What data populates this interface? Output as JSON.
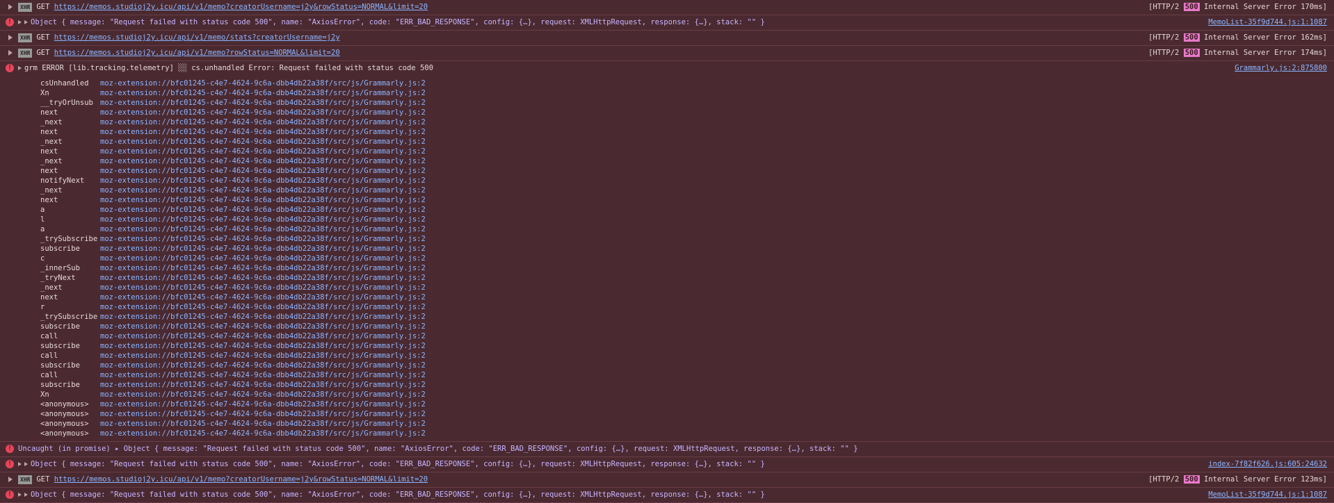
{
  "rows": [
    {
      "type": "xhr",
      "method": "GET",
      "url": "https://memos.studioj2y.icu/api/v1/memo?creatorUsername=j2y&rowStatus=NORMAL&limit=20",
      "status_prefix": "[HTTP/2",
      "status_code": "500",
      "status_suffix": "Internal Server Error 170ms]"
    },
    {
      "type": "error",
      "text": "Object { message: \"Request failed with status code 500\", name: \"AxiosError\", code: \"ERR_BAD_RESPONSE\", config: {…}, request: XMLHttpRequest, response: {…}, stack: \"\" }",
      "source": "MemoList-35f9d744.js:1:1087"
    },
    {
      "type": "xhr",
      "method": "GET",
      "url": "https://memos.studioj2y.icu/api/v1/memo/stats?creatorUsername=j2y",
      "status_prefix": "[HTTP/2",
      "status_code": "500",
      "status_suffix": "Internal Server Error 162ms]"
    },
    {
      "type": "xhr",
      "method": "GET",
      "url": "https://memos.studioj2y.icu/api/v1/memo?rowStatus=NORMAL&limit=20",
      "status_prefix": "[HTTP/2",
      "status_code": "500",
      "status_suffix": "Internal Server Error 174ms]"
    }
  ],
  "grm": {
    "text": "grm ERROR [lib.tracking.telemetry] ░░ cs.unhandled Error: Request failed with status code 500",
    "source": "Grammarly.js:2:875800",
    "location": "moz-extension://bfc01245-c4e7-4624-9c6a-dbb4db22a38f/src/js/Grammarly.js:2",
    "frames": [
      "csUnhandled",
      "Xn",
      "__tryOrUnsub",
      "next",
      "_next",
      "next",
      "_next",
      "next",
      "_next",
      "next",
      "notifyNext",
      "_next",
      "next",
      "a",
      "l",
      "a",
      "_trySubscribe",
      "subscribe",
      "c",
      "_innerSub",
      "_tryNext",
      "_next",
      "next",
      "r",
      "_trySubscribe",
      "subscribe",
      "call",
      "subscribe",
      "call",
      "subscribe",
      "call",
      "subscribe",
      "Xn",
      "<anonymous>",
      "<anonymous>",
      "<anonymous>",
      "<anonymous>"
    ]
  },
  "rows2": [
    {
      "type": "uncaught",
      "text": "Uncaught (in promise) ▸ Object { message: \"Request failed with status code 500\", name: \"AxiosError\", code: \"ERR_BAD_RESPONSE\", config: {…}, request: XMLHttpRequest, response: {…}, stack: \"\" }",
      "source": ""
    },
    {
      "type": "error",
      "text": "Object { message: \"Request failed with status code 500\", name: \"AxiosError\", code: \"ERR_BAD_RESPONSE\", config: {…}, request: XMLHttpRequest, response: {…}, stack: \"\" }",
      "source": "index-7f82f626.js:605:24632"
    },
    {
      "type": "xhr",
      "method": "GET",
      "url": "https://memos.studioj2y.icu/api/v1/memo?creatorUsername=j2y&rowStatus=NORMAL&limit=20",
      "status_prefix": "[HTTP/2",
      "status_code": "500",
      "status_suffix": "Internal Server Error 123ms]"
    },
    {
      "type": "error",
      "text": "Object { message: \"Request failed with status code 500\", name: \"AxiosError\", code: \"ERR_BAD_RESPONSE\", config: {…}, request: XMLHttpRequest, response: {…}, stack: \"\" }",
      "source": "MemoList-35f9d744.js:1:1087"
    }
  ],
  "labels": {
    "xhr_badge": "XHR"
  }
}
